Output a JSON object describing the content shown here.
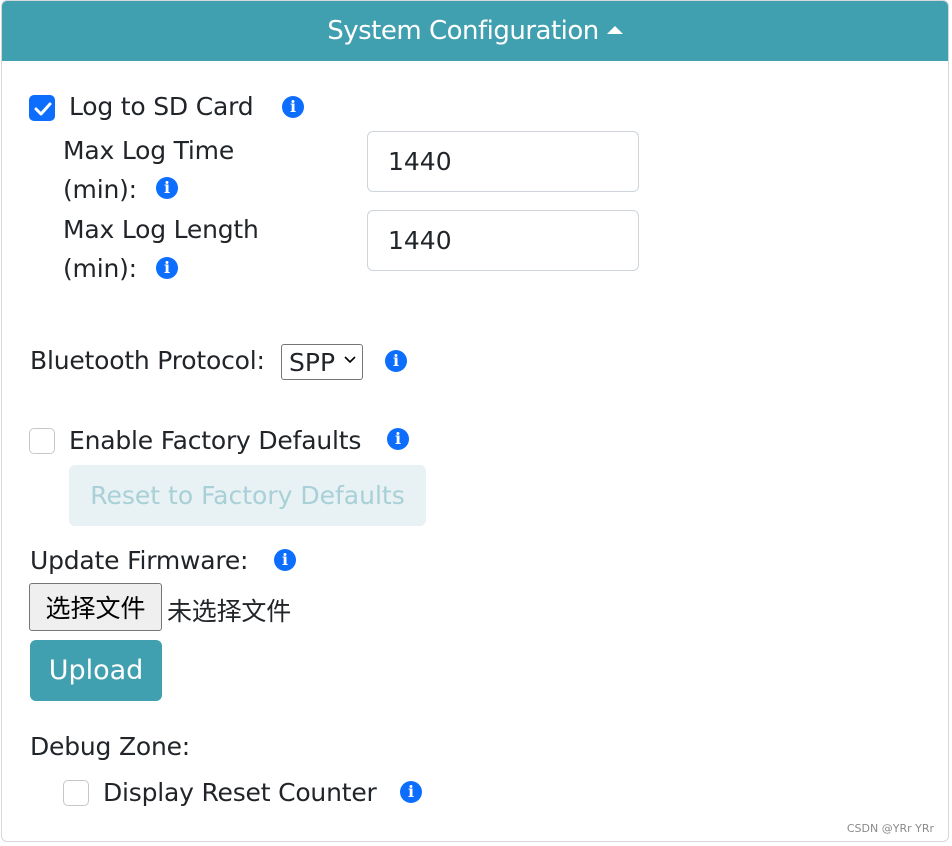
{
  "header": {
    "title": "System Configuration",
    "caret_icon": "caret-up-icon"
  },
  "log_sd": {
    "label": "Log to SD Card",
    "checked": true,
    "max_time_label_line1": "Max Log Time",
    "max_time_label_line2": "(min):",
    "max_time_value": "1440",
    "max_length_label_line1": "Max Log Length",
    "max_length_label_line2": "(min):",
    "max_length_value": "1440"
  },
  "bluetooth": {
    "label": "Bluetooth Protocol:",
    "selected": "SPP"
  },
  "factory": {
    "label": "Enable Factory Defaults",
    "checked": false,
    "reset_button": "Reset to Factory Defaults"
  },
  "firmware": {
    "label": "Update Firmware:",
    "choose_file_button": "选择文件",
    "no_file_text": "未选择文件",
    "upload_button": "Upload"
  },
  "debug": {
    "label": "Debug Zone:",
    "reset_counter_label": "Display Reset Counter",
    "reset_counter_checked": false
  },
  "watermark": "CSDN @YRr YRr",
  "colors": {
    "header_bg": "#41a0b0",
    "info_icon": "#0d6efd",
    "checkbox_checked": "#0d6efd"
  },
  "info_icon_glyph": "i"
}
